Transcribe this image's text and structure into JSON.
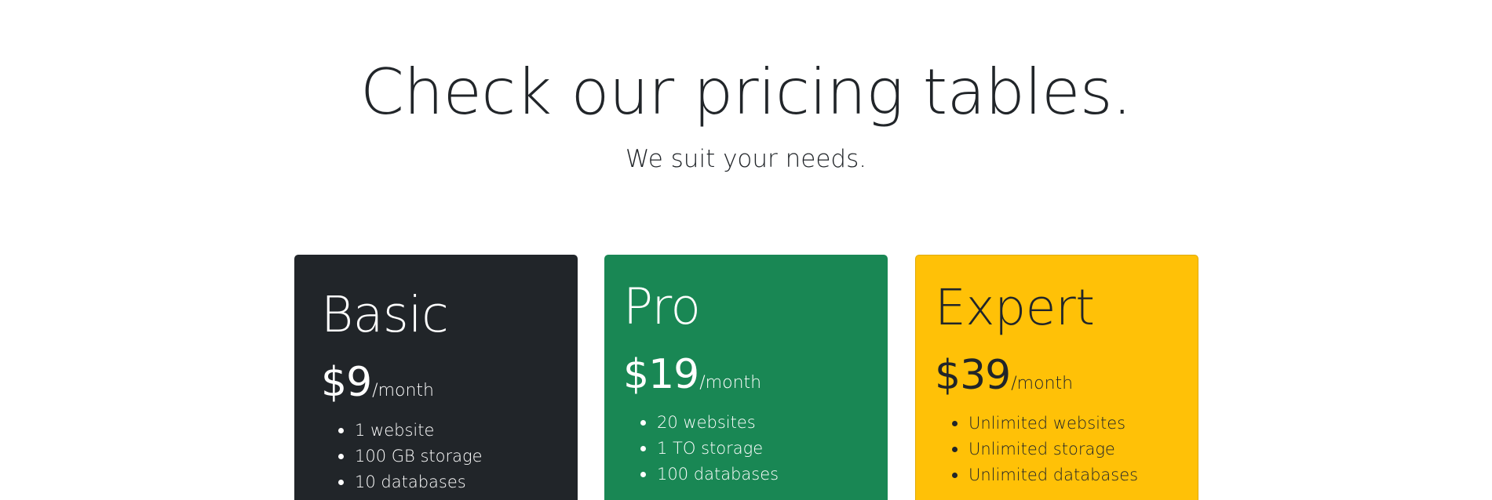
{
  "header": {
    "title": "Check our pricing tables.",
    "subtitle": "We suit your needs."
  },
  "plans": [
    {
      "name": "Basic",
      "price": "$9",
      "period": "/month",
      "color": "#212529",
      "features": [
        "1 website",
        "100 GB storage",
        "10 databases"
      ]
    },
    {
      "name": "Pro",
      "price": "$19",
      "period": "/month",
      "color": "#198754",
      "features": [
        "20 websites",
        "1 TO storage",
        "100 databases"
      ]
    },
    {
      "name": "Expert",
      "price": "$39",
      "period": "/month",
      "color": "#ffc107",
      "features": [
        "Unlimited websites",
        "Unlimited storage",
        "Unlimited databases"
      ]
    }
  ]
}
